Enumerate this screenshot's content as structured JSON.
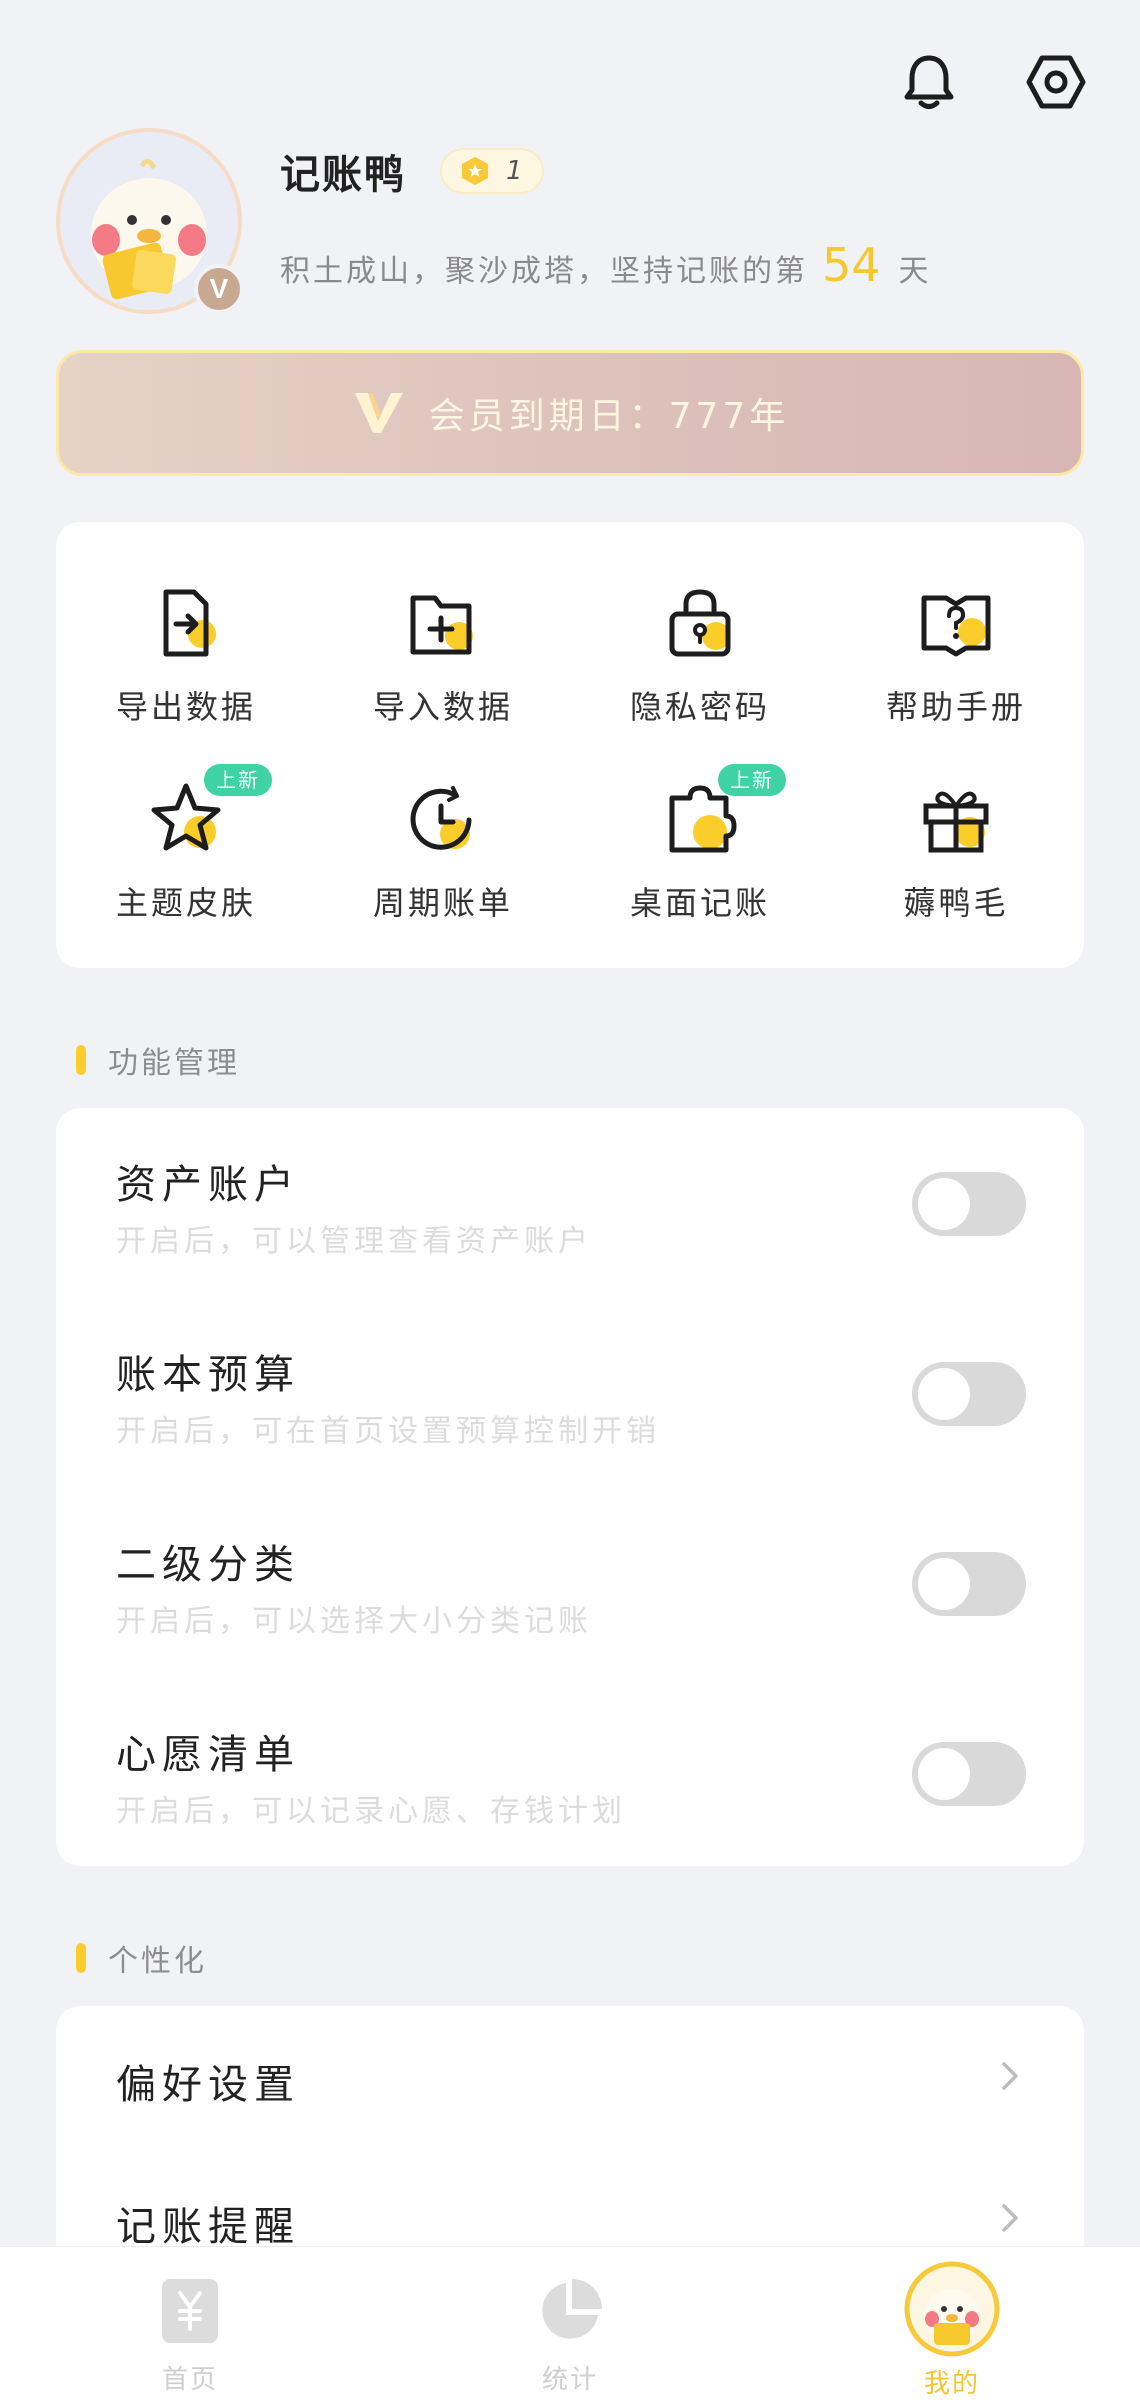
{
  "header": {
    "icons": [
      "bell-icon",
      "settings-hex-icon"
    ]
  },
  "profile": {
    "username": "记账鸭",
    "level": "1",
    "vip_badge": "V",
    "streak_prefix": "积土成山，聚沙成塔，坚持记账的第",
    "streak_days": "54",
    "streak_suffix": "天"
  },
  "member": {
    "text": "会员到期日：777年"
  },
  "quick_actions": [
    {
      "label": "导出数据",
      "icon": "export-file-icon"
    },
    {
      "label": "导入数据",
      "icon": "import-folder-icon"
    },
    {
      "label": "隐私密码",
      "icon": "lock-icon"
    },
    {
      "label": "帮助手册",
      "icon": "help-book-icon"
    },
    {
      "label": "主题皮肤",
      "icon": "star-icon",
      "tag": "上新"
    },
    {
      "label": "周期账单",
      "icon": "clock-icon"
    },
    {
      "label": "桌面记账",
      "icon": "widget-icon",
      "tag": "上新"
    },
    {
      "label": "薅鸭毛",
      "icon": "gift-icon"
    }
  ],
  "features_section": {
    "title": "功能管理",
    "items": [
      {
        "title": "资产账户",
        "desc": "开启后，可以管理查看资产账户",
        "enabled": false
      },
      {
        "title": "账本预算",
        "desc": "开启后，可在首页设置预算控制开销",
        "enabled": false
      },
      {
        "title": "二级分类",
        "desc": "开启后，可以选择大小分类记账",
        "enabled": false
      },
      {
        "title": "心愿清单",
        "desc": "开启后，可以记录心愿、存钱计划",
        "enabled": false
      }
    ]
  },
  "personal_section": {
    "title": "个性化",
    "items": [
      {
        "title": "偏好设置"
      },
      {
        "title": "记账提醒"
      }
    ]
  },
  "tabbar": {
    "tabs": [
      {
        "label": "首页",
        "icon": "yuan-note-icon",
        "active": false
      },
      {
        "label": "统计",
        "icon": "pie-chart-icon",
        "active": false
      },
      {
        "label": "我的",
        "icon": "duck-avatar-icon",
        "active": true
      }
    ]
  },
  "colors": {
    "accent": "#fbcd2b",
    "new_tag": "#3fd2a4",
    "background": "#f1f2f6",
    "toggle_off": "#d9d9d9"
  }
}
